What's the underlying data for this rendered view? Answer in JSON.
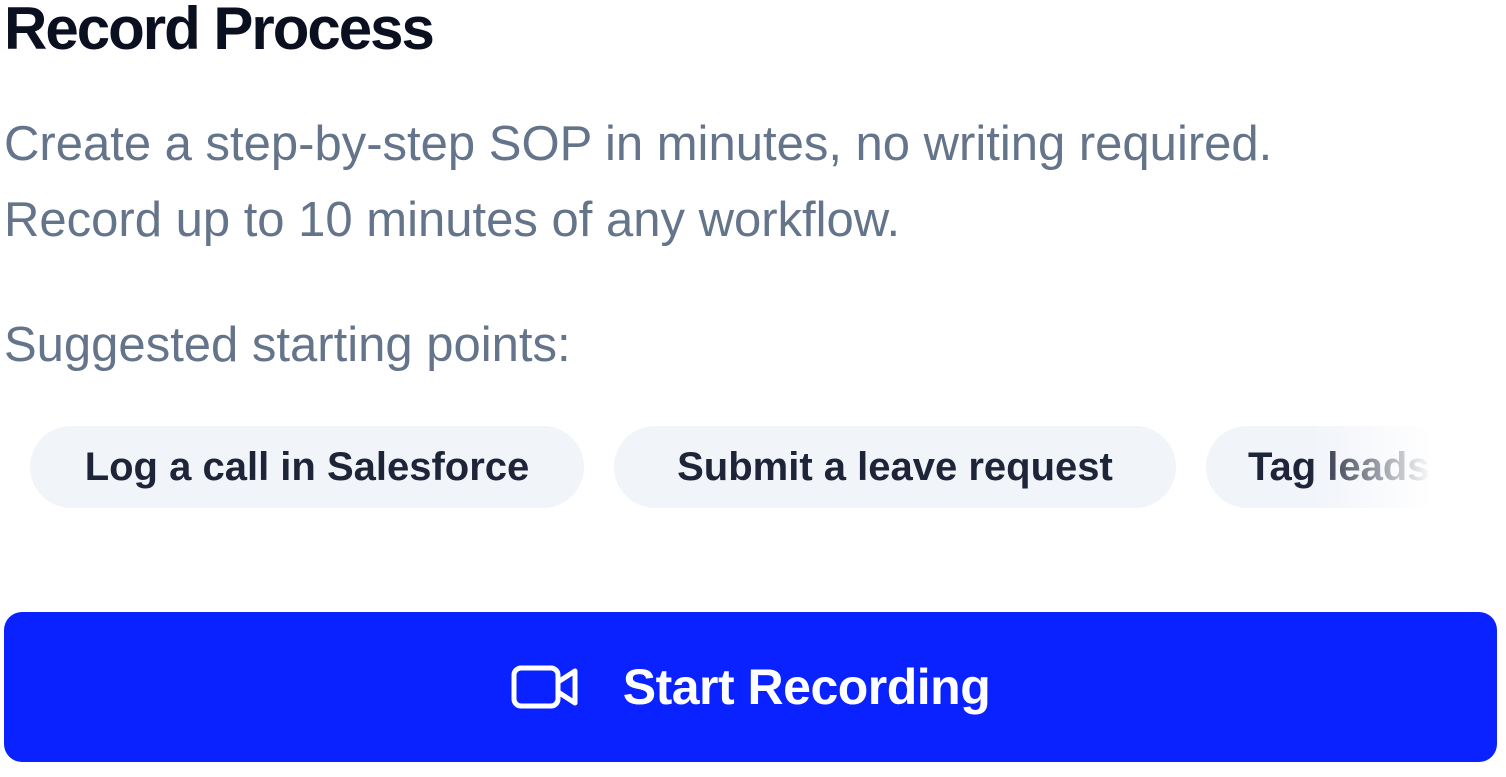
{
  "header": {
    "title": "Record Process"
  },
  "description": {
    "line1": "Create a step-by-step SOP in minutes, no writing required.",
    "line2": "Record up to 10 minutes of any workflow."
  },
  "suggestions": {
    "label": "Suggested starting points:",
    "items": [
      {
        "label": "Log a call in Salesforce"
      },
      {
        "label": "Submit a leave request"
      },
      {
        "label": "Tag leads"
      }
    ]
  },
  "actions": {
    "start_recording_label": "Start Recording",
    "start_recording_icon": "video-camera-icon",
    "button_color": "#0a22ff"
  }
}
